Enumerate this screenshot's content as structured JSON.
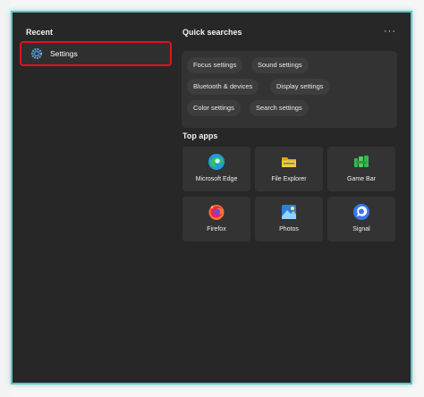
{
  "recent": {
    "title": "Recent",
    "items": [
      {
        "label": "Settings",
        "icon": "settings-gear-icon"
      }
    ]
  },
  "quick_searches": {
    "title": "Quick searches",
    "more_label": "···",
    "chips": [
      "Focus settings",
      "Sound settings",
      "Bluetooth & devices",
      "Display settings",
      "Color settings",
      "Search settings"
    ]
  },
  "top_apps": {
    "title": "Top apps",
    "apps": [
      {
        "label": "Microsoft Edge",
        "icon": "edge-icon"
      },
      {
        "label": "File Explorer",
        "icon": "file-explorer-icon"
      },
      {
        "label": "Game Bar",
        "icon": "game-bar-icon"
      },
      {
        "label": "Firefox",
        "icon": "firefox-icon"
      },
      {
        "label": "Photos",
        "icon": "photos-icon"
      },
      {
        "label": "Signal",
        "icon": "signal-icon"
      }
    ]
  },
  "colors": {
    "panel_background": "#272727",
    "panel_border": "#58c8c4",
    "highlight_outline": "#e3111c"
  }
}
